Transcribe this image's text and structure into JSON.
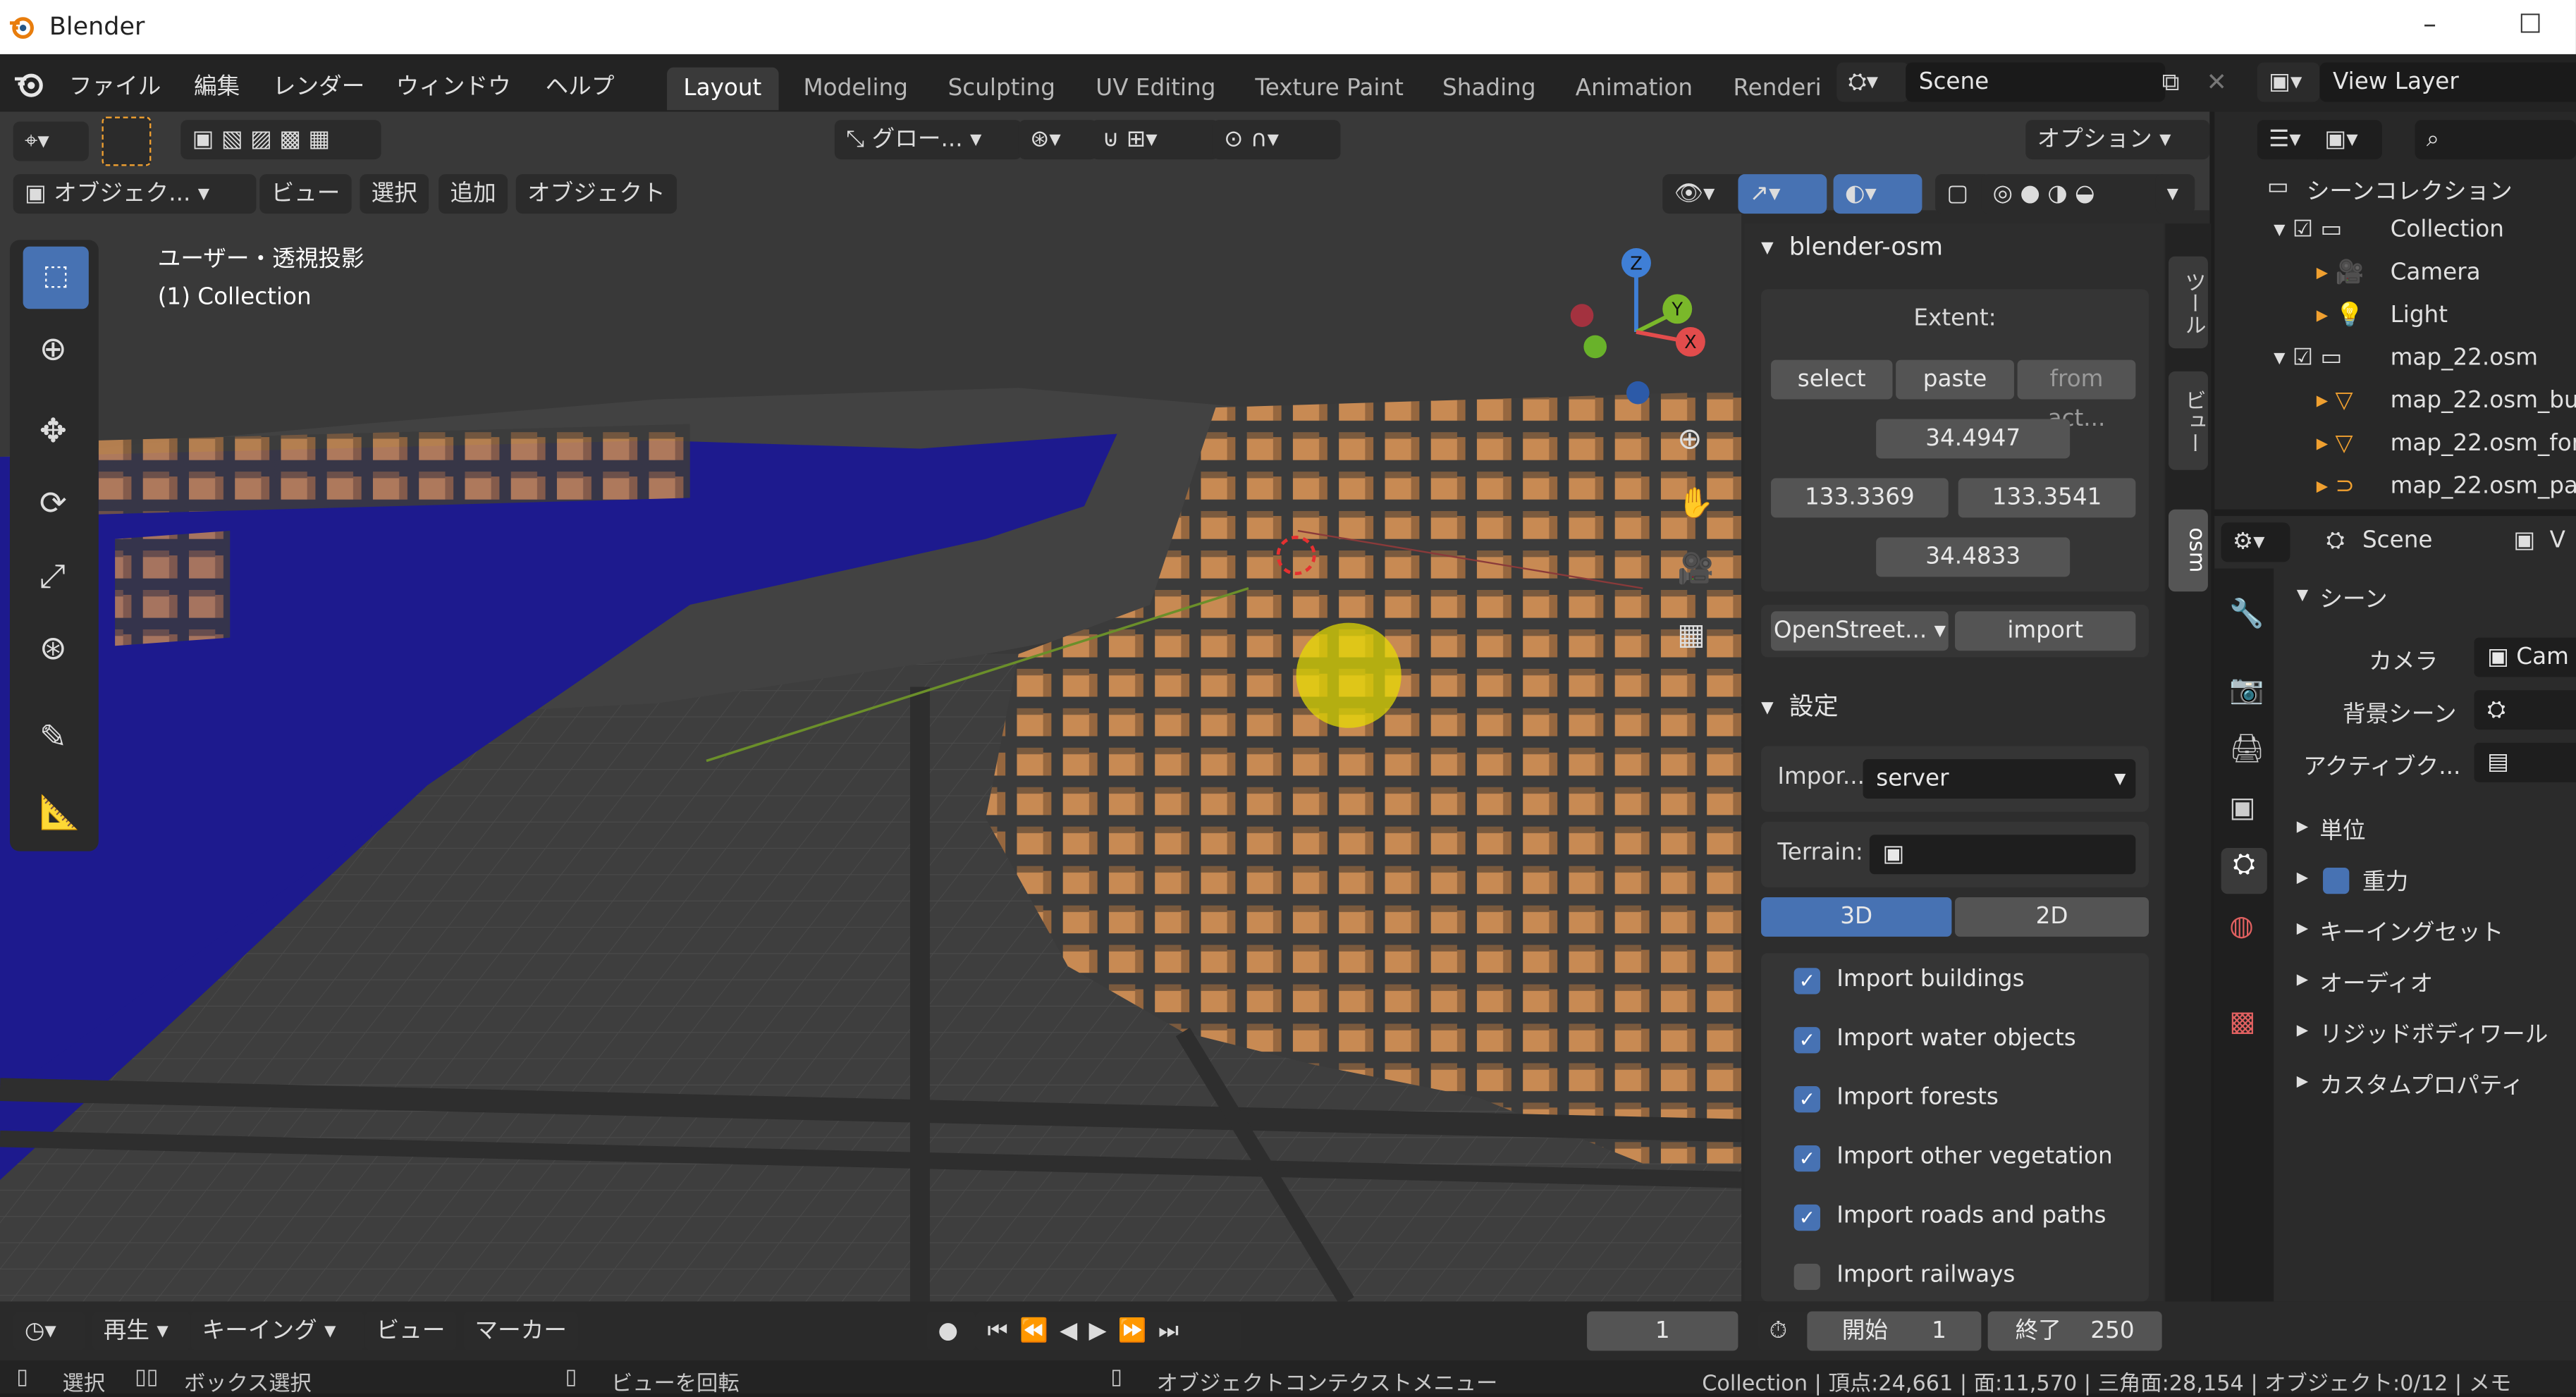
{
  "window": {
    "title": "Blender",
    "minimize": "–",
    "maximize": "☐"
  },
  "menu": [
    "ファイル",
    "編集",
    "レンダー",
    "ウィンドウ",
    "ヘルプ"
  ],
  "workspaces": [
    "Layout",
    "Modeling",
    "Sculpting",
    "UV Editing",
    "Texture Paint",
    "Shading",
    "Animation",
    "Renderi"
  ],
  "scene_name": "Scene",
  "view_layer": "View Layer",
  "viewport_header": {
    "orientation": "グロー...",
    "options": "オプション",
    "mode": "オブジェク...",
    "menus": [
      "ビュー",
      "選択",
      "追加",
      "オブジェクト"
    ]
  },
  "overlay": {
    "view_name": "ユーザー・透視投影",
    "collection": "(1) Collection"
  },
  "gizmo": {
    "z": "Z",
    "y": "Y",
    "x": "X"
  },
  "osm_panel": {
    "title": "blender-osm",
    "extent_label": "Extent:",
    "buttons": [
      "select",
      "paste",
      "from act..."
    ],
    "max_lat": "34.4947",
    "min_lon": "133.3369",
    "max_lon": "133.3541",
    "min_lat": "34.4833",
    "source": "OpenStreet...",
    "import_label": "import"
  },
  "settings_panel": {
    "title": "設定",
    "import_label": "Impor...",
    "import_value": "server",
    "terrain_label": "Terrain:",
    "mode_3d": "3D",
    "mode_2d": "2D",
    "checks": [
      {
        "label": "Import buildings",
        "checked": true
      },
      {
        "label": "Import water objects",
        "checked": true
      },
      {
        "label": "Import forests",
        "checked": true
      },
      {
        "label": "Import other vegetation",
        "checked": true
      },
      {
        "label": "Import roads and paths",
        "checked": true
      },
      {
        "label": "Import railways",
        "checked": false
      }
    ]
  },
  "side_tabs": [
    "ツール",
    "ビュー",
    "osm"
  ],
  "outliner": {
    "root": "シーンコレクション",
    "items": [
      "Collection",
      "Camera",
      "Light",
      "map_22.osm",
      "map_22.osm_bu",
      "map_22.osm_for",
      "map_22.osm_pa"
    ]
  },
  "properties": {
    "header": "Scene",
    "header2": "V",
    "section": "シーン",
    "camera_label": "カメラ",
    "camera_value": "Cam",
    "bg_label": "背景シーン",
    "clip_label": "アクティブク...",
    "subsections": [
      "単位",
      "重力",
      "キーイングセット",
      "オーディオ",
      "リジッドボディワール",
      "カスタムプロパティ"
    ]
  },
  "timeline": {
    "playback": "再生",
    "keying": "キーイング",
    "view": "ビュー",
    "marker": "マーカー",
    "current_frame": "1",
    "start_label": "開始",
    "start": "1",
    "end_label": "終了",
    "end": "250"
  },
  "statusbar": {
    "select": "選択",
    "box_select": "ボックス選択",
    "rotate": "ビューを回転",
    "context": "オブジェクトコンテクストメニュー",
    "stats": "Collection | 頂点:24,661 | 面:11,570 | 三角面:28,154 | オブジェクト:0/12 | メモ"
  }
}
